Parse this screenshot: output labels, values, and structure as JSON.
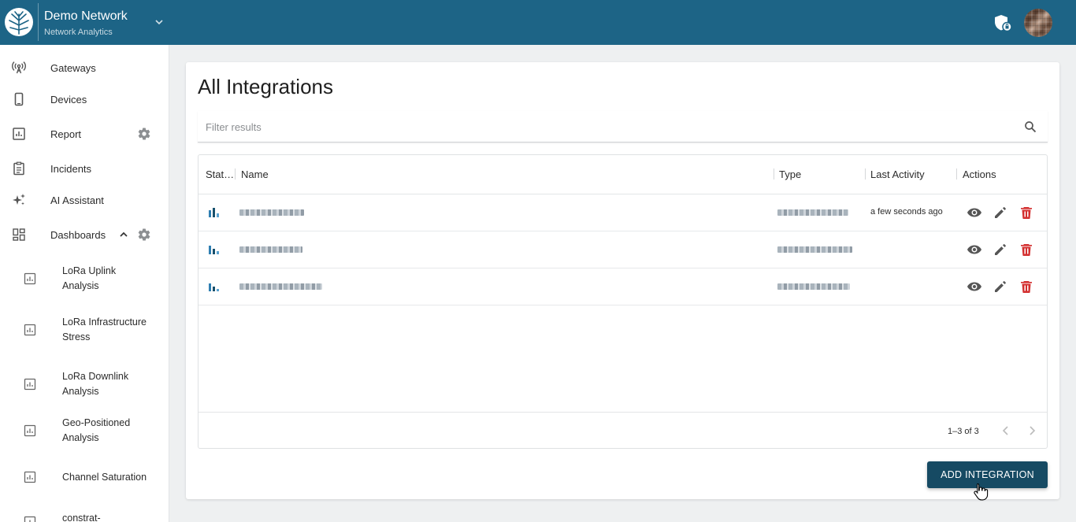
{
  "header": {
    "network_name": "Demo Network",
    "network_subtitle": "Network Analytics"
  },
  "sidebar": {
    "items": [
      {
        "label": "Gateways",
        "icon": "gateway-icon"
      },
      {
        "label": "Devices",
        "icon": "device-icon"
      },
      {
        "label": "Report",
        "icon": "report-icon",
        "has_settings": true
      },
      {
        "label": "Incidents",
        "icon": "incidents-icon"
      },
      {
        "label": "AI Assistant",
        "icon": "sparkle-icon"
      },
      {
        "label": "Dashboards",
        "icon": "dashboard-icon",
        "expanded": true,
        "has_settings": true
      }
    ],
    "dashboards": [
      "LoRa Uplink Analysis",
      "LoRa Infrastructure Stress",
      "LoRa Downlink Analysis",
      "Geo-Positioned Analysis",
      "Channel Saturation",
      "constrat-"
    ]
  },
  "main": {
    "title": "All Integrations",
    "filter_placeholder": "Filter results",
    "columns": [
      "Stat…",
      "Name",
      "Type",
      "Last Activity",
      "Actions"
    ],
    "rows": [
      {
        "last_activity": "a few seconds ago"
      },
      {
        "last_activity": ""
      },
      {
        "last_activity": ""
      }
    ],
    "pagination": "1–3 of 3",
    "add_button": "ADD INTEGRATION"
  },
  "colors": {
    "header_bg": "#1d6486",
    "primary_button": "#164a63",
    "delete_red": "#d32f2f"
  }
}
